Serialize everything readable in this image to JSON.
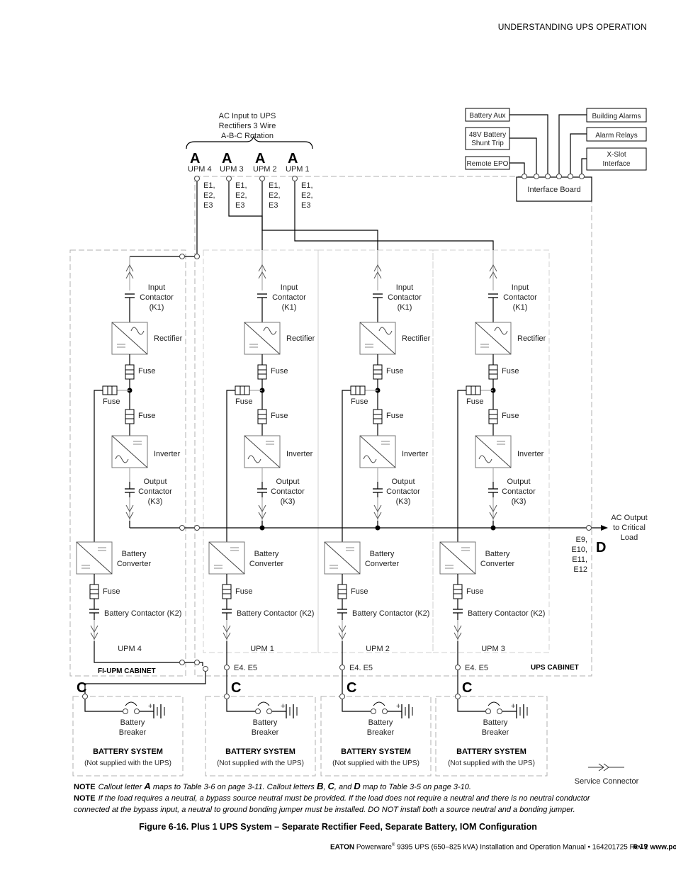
{
  "header": {
    "section_title": "UNDERSTANDING UPS OPERATION"
  },
  "ac_input": {
    "title_lines": [
      "AC Input to UPS",
      "Rectifiers 3 Wire",
      "A-B-C Rotation"
    ],
    "callout": "A",
    "inputs": [
      {
        "upm": "UPM  4",
        "terminals": [
          "E1,",
          "E2,",
          "E3"
        ]
      },
      {
        "upm": "UPM  3",
        "terminals": [
          "E1,",
          "E2,",
          "E3"
        ]
      },
      {
        "upm": "UPM  2",
        "terminals": [
          "E1,",
          "E2,",
          "E3"
        ]
      },
      {
        "upm": "UPM  1",
        "terminals": [
          "E1,",
          "E2,",
          "E3"
        ]
      }
    ]
  },
  "interface": {
    "board_label": "Interface Board",
    "left_connections": [
      {
        "lines": [
          "Battery Aux"
        ]
      },
      {
        "lines": [
          "48V Battery",
          "Shunt Trip"
        ]
      },
      {
        "lines": [
          "Remote EPO"
        ]
      }
    ],
    "right_connections": [
      {
        "lines": [
          "Building Alarms"
        ]
      },
      {
        "lines": [
          "Alarm Relays"
        ]
      },
      {
        "lines": [
          "X-Slot",
          "Interface"
        ]
      }
    ]
  },
  "modules": [
    {
      "name": "UPM 4"
    },
    {
      "name": "UPM 1"
    },
    {
      "name": "UPM 2"
    },
    {
      "name": "UPM 3"
    }
  ],
  "components": {
    "input_contactor": [
      "Input",
      "Contactor",
      "(K1)"
    ],
    "rectifier": "Rectifier",
    "fuse": "Fuse",
    "inverter": "Inverter",
    "output_contactor": [
      "Output",
      "Contactor",
      "(K3)"
    ],
    "battery_converter": [
      "Battery",
      "Converter"
    ],
    "battery_contactor": "Battery Contactor (K2)"
  },
  "cabinets": {
    "fi_upm": "FI-UPM CABINET",
    "ups": "UPS CABINET"
  },
  "ac_output": {
    "label_lines": [
      "AC Output",
      "to Critical",
      "Load"
    ],
    "terminals": [
      "E9,",
      "E10,",
      "E11,",
      "E12"
    ],
    "callout": "D"
  },
  "battery_terminals": "E4. E5",
  "battery_callout": "C",
  "battery_system": {
    "breaker_lines": [
      "Battery",
      "Breaker"
    ],
    "title": "BATTERY SYSTEM",
    "subtitle": "(Not supplied with the UPS)",
    "plus": "+"
  },
  "legend": {
    "service_connector": "Service Connector"
  },
  "notes": [
    {
      "keyword": "NOTE",
      "parts": [
        "Callout letter ",
        "A",
        " maps to Table 3-6 on page 3-11. Callout letters ",
        "B",
        ", ",
        "C",
        ", and ",
        "D",
        " map to Table 3-5 on page 3-10."
      ]
    },
    {
      "keyword": "NOTE",
      "text": "If the load requires a neutral, a bypass source neutral must be provided. If the load does not require a neutral and there is no neutral conductor connected at the bypass input, a neutral to ground bonding jumper must be installed. DO NOT install both a source neutral and a bonding jumper."
    }
  ],
  "caption": "Figure 6-16. Plus 1 UPS System – Separate Rectifier Feed, Separate Battery, IOM Configuration",
  "footer": {
    "brand": "EATON",
    "product": "Powerware",
    "reg": "®",
    "rest": " 9395 UPS (650–825 kVA) Installation and Operation Manual  •  164201725 Rev 2 ",
    "url": "www.powerware.com",
    "page": "6-19"
  }
}
